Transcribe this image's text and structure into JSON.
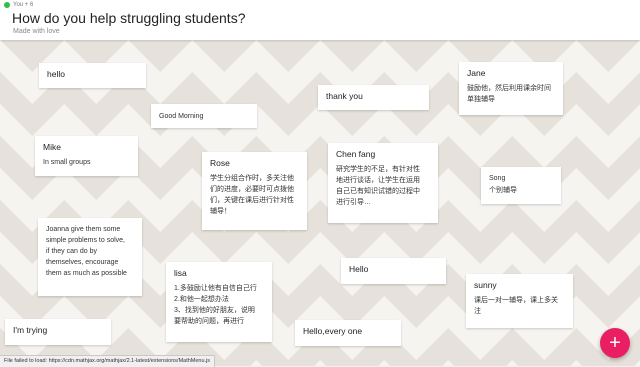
{
  "header": {
    "author": "You + 6",
    "title": "How do you help struggling students?",
    "subtitle": "Made with love"
  },
  "cards": [
    {
      "title": "hello"
    },
    {
      "title": "Good Morning"
    },
    {
      "title": "thank you"
    },
    {
      "title": "Jane",
      "body": [
        "鼓励他，然后利用课余时间",
        "单独辅导"
      ]
    },
    {
      "title": "Mike",
      "body": [
        "In small groups"
      ]
    },
    {
      "title": "Rose",
      "body": [
        "学生分组合作时，多关注他",
        "们的进度，必要时可点拨他",
        "们，关键在课后进行针对性",
        "辅导！"
      ]
    },
    {
      "title": "Chen fang",
      "body": [
        "研究学生的不足，有针对性",
        "地进行谈话，让学生在运用",
        "自己已有知识试错的过程中",
        "进行引导…"
      ]
    },
    {
      "title": "Song",
      "body": [
        "个别辅导"
      ]
    },
    {
      "title": "Joanna  give them some",
      "body": [
        "simple problems to solve,",
        "if they can do by",
        "themselves, encourage",
        "them as much as possible"
      ]
    },
    {
      "title": "lisa",
      "body": [
        "1.多鼓励让他有自信自己行",
        "2.和他一起想办法",
        "3、找到他的好朋友，说明",
        "要帮助的问题，再进行"
      ]
    },
    {
      "title": "Hello"
    },
    {
      "title": "sunny",
      "body": [
        "课后一对一辅导，课上多关",
        "注"
      ]
    },
    {
      "title": "I'm  trying"
    },
    {
      "title": "Hello,every one"
    }
  ],
  "status_text": "File failed to load: https://cdn.mathjax.org/mathjax/2.1-latest/extensions/MathMenu.js",
  "fab_label": "+"
}
